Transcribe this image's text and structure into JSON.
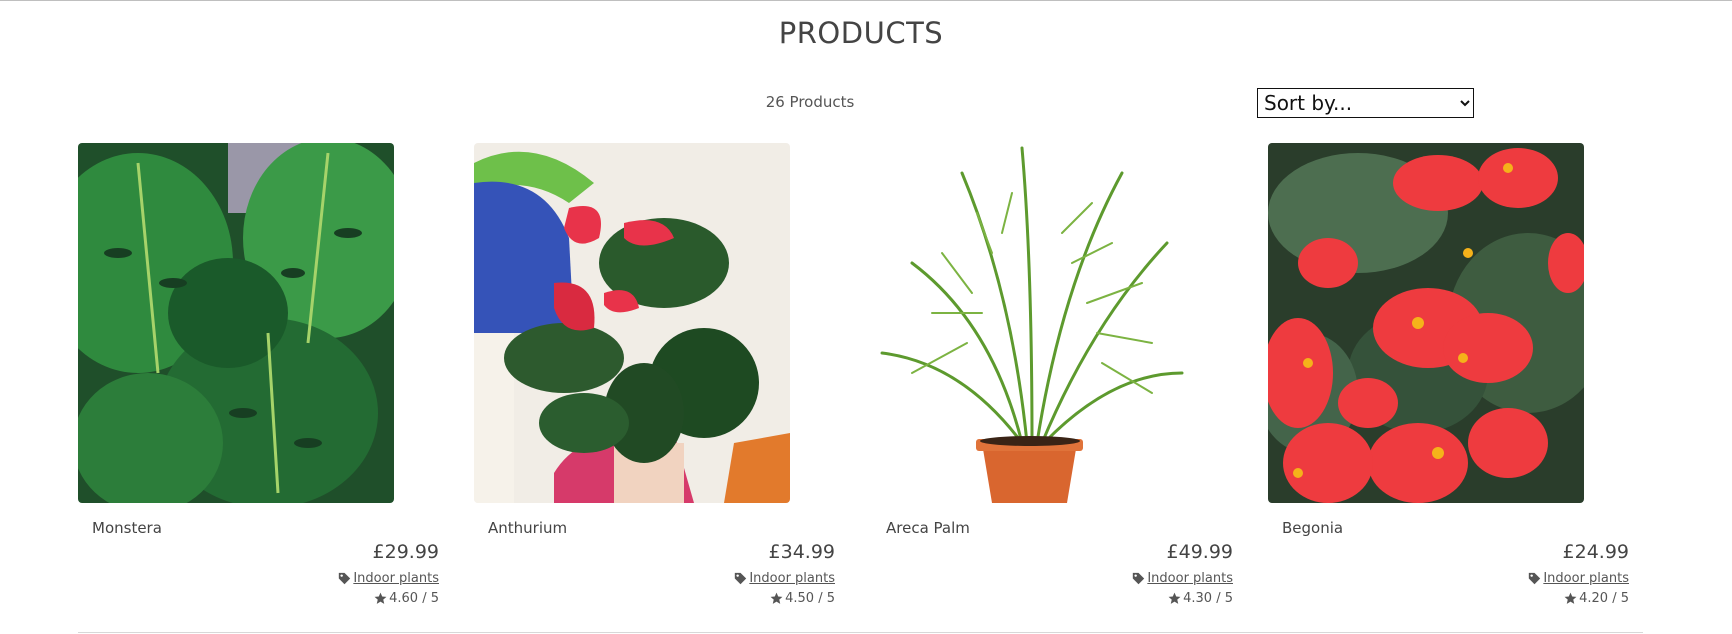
{
  "header": {
    "title": "PRODUCTS"
  },
  "toolbar": {
    "product_count": "26 Products",
    "sort_selected": "Sort by..."
  },
  "products": [
    {
      "name": "Monstera",
      "price": "£29.99",
      "category": "Indoor plants",
      "rating": "4.60 / 5",
      "image": "monstera-leaves"
    },
    {
      "name": "Anthurium",
      "price": "£34.99",
      "category": "Indoor plants",
      "rating": "4.50 / 5",
      "image": "anthurium-red-flowers"
    },
    {
      "name": "Areca Palm",
      "price": "£49.99",
      "category": "Indoor plants",
      "rating": "4.30 / 5",
      "image": "areca-palm-in-pot"
    },
    {
      "name": "Begonia",
      "price": "£24.99",
      "category": "Indoor plants",
      "rating": "4.20 / 5",
      "image": "begonia-red-flowers"
    }
  ],
  "icons": {
    "category": "tag-icon",
    "rating": "star-icon"
  },
  "colors": {
    "text": "#444444",
    "divider": "#d8d8d8"
  }
}
